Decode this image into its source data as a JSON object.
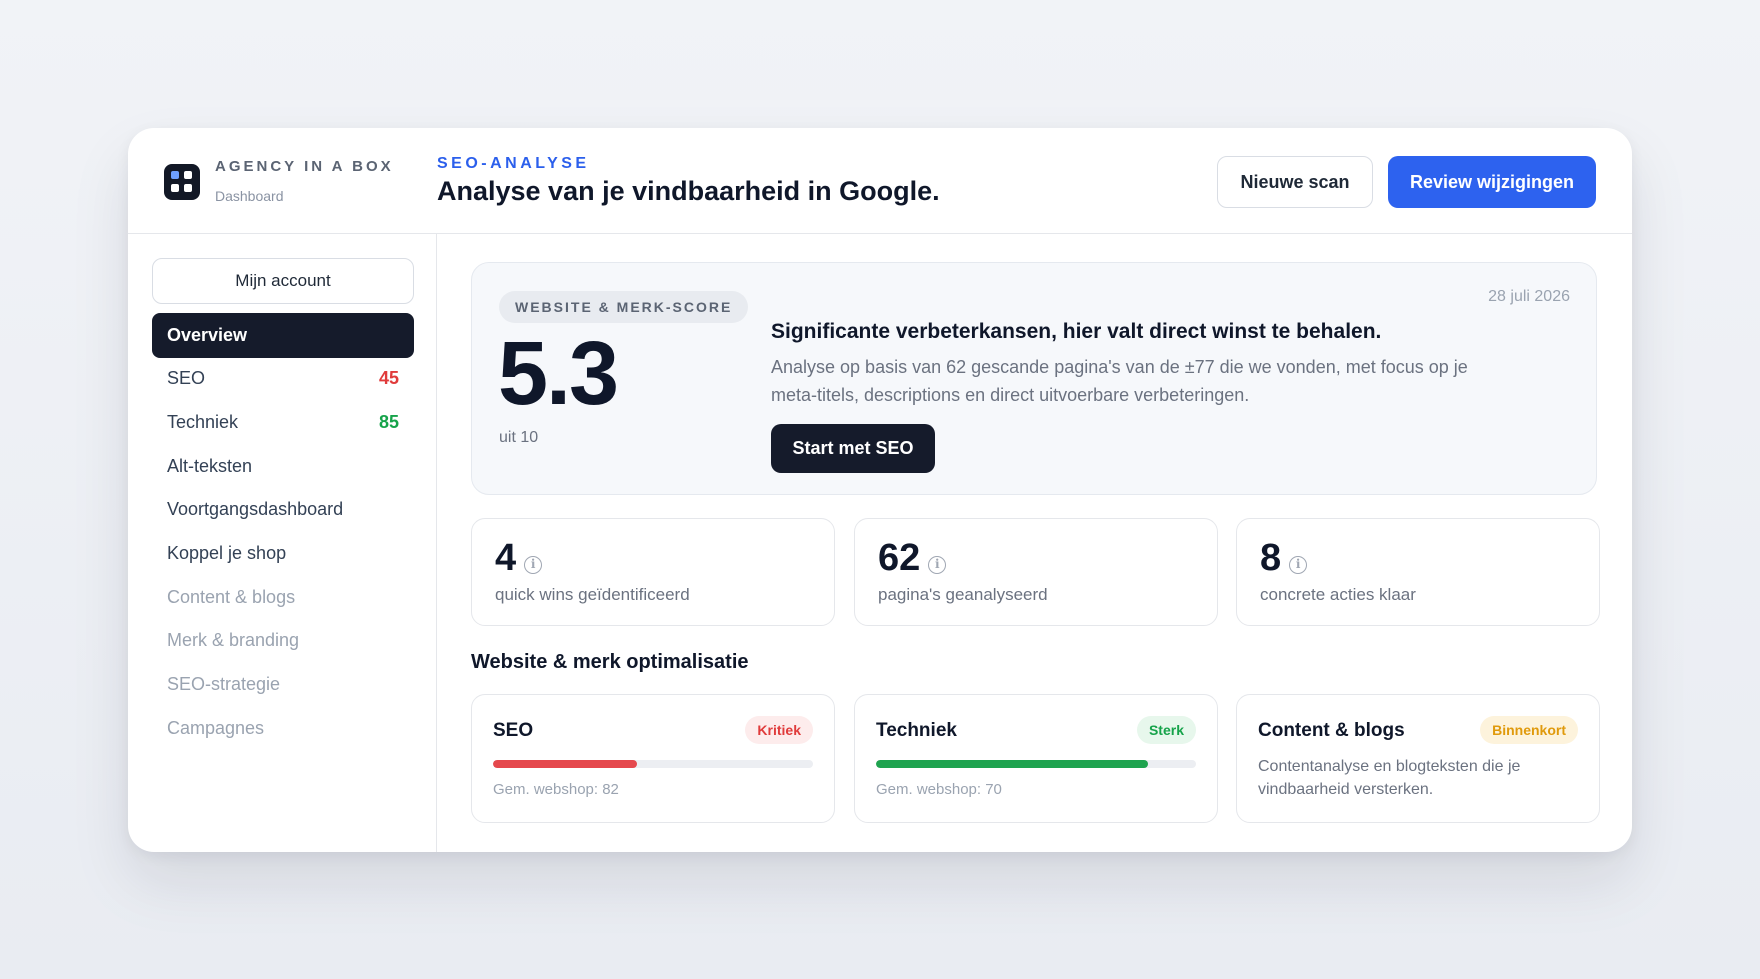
{
  "brand": {
    "name": "AGENCY IN A BOX",
    "subtitle": "Dashboard"
  },
  "header": {
    "eyebrow": "SEO-ANALYSE",
    "title": "Analyse van je vindbaarheid in Google.",
    "new_scan_label": "Nieuwe scan",
    "review_label": "Review wijzigingen"
  },
  "sidebar": {
    "account_label": "Mijn account",
    "items": [
      {
        "label": "Overview",
        "count": "",
        "state": "active"
      },
      {
        "label": "SEO",
        "count": "45",
        "count_color": "#e03b3b",
        "state": "normal"
      },
      {
        "label": "Techniek",
        "count": "85",
        "count_color": "#16a34a",
        "state": "normal"
      },
      {
        "label": "Alt-teksten",
        "count": "",
        "state": "normal"
      },
      {
        "label": "Voortgangsdashboard",
        "count": "",
        "state": "normal"
      },
      {
        "label": "Koppel je shop",
        "count": "",
        "state": "normal"
      },
      {
        "label": "Content & blogs",
        "count": "",
        "state": "muted"
      },
      {
        "label": "Merk & branding",
        "count": "",
        "state": "muted"
      },
      {
        "label": "SEO-strategie",
        "count": "",
        "state": "muted"
      },
      {
        "label": "Campagnes",
        "count": "",
        "state": "muted"
      }
    ]
  },
  "hero": {
    "pill": "WEBSITE & MERK-SCORE",
    "score": "5.3",
    "score_sub": "uit 10",
    "date": "28 juli 2026",
    "title": "Significante verbeterkansen, hier valt direct winst te behalen.",
    "description": "Analyse op basis van 62 gescande pagina's van de ±77 die we vonden, met focus op je meta-titels, descriptions en direct uitvoerbare verbeteringen.",
    "cta_label": "Start met SEO"
  },
  "stats": [
    {
      "value": "4",
      "label": "quick wins geïdentificeerd"
    },
    {
      "value": "62",
      "label": "pagina's geanalyseerd"
    },
    {
      "value": "8",
      "label": "concrete acties klaar"
    }
  ],
  "section_title": "Website & merk optimalisatie",
  "cards": [
    {
      "title": "SEO",
      "badge": "Kritiek",
      "badge_color": "#e03b3b",
      "badge_bg": "#fdecec",
      "progress": 0.45,
      "bar_color": "#e5484d",
      "meta": "Gem. webshop: 82"
    },
    {
      "title": "Techniek",
      "badge": "Sterk",
      "badge_color": "#16a34a",
      "badge_bg": "#e7f7ec",
      "progress": 0.85,
      "bar_color": "#1fa34f",
      "meta": "Gem. webshop: 70"
    },
    {
      "title": "Content & blogs",
      "badge": "Binnenkort",
      "badge_color": "#e09a0c",
      "badge_bg": "#fdf3dc",
      "description": "Contentanalyse en blogteksten die je vindbaarheid versterken."
    }
  ],
  "colors": {
    "accent": "#2d62ef",
    "dark": "#151b2b"
  },
  "icons": {
    "logo": "grid-icon",
    "info": "info-icon"
  }
}
